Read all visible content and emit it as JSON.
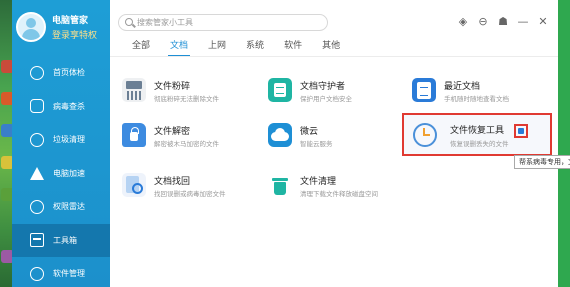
{
  "window": {
    "profile": {
      "name": "电脑管家",
      "vip_link": "登录享特权"
    },
    "sidebar": {
      "items": [
        {
          "label": "首页体检",
          "icon": "home-icon"
        },
        {
          "label": "病毒查杀",
          "icon": "shield-icon"
        },
        {
          "label": "垃圾清理",
          "icon": "trash-icon"
        },
        {
          "label": "电脑加速",
          "icon": "rocket-icon"
        },
        {
          "label": "权限雷达",
          "icon": "radar-icon"
        },
        {
          "label": "工具箱",
          "icon": "toolbox-icon",
          "active": true
        },
        {
          "label": "软件管理",
          "icon": "apps-icon"
        }
      ]
    },
    "search": {
      "placeholder": "搜索管家小工具"
    },
    "toolbar": {
      "icons": [
        "skin-icon",
        "menu-icon",
        "shirt-icon",
        "minimize-icon",
        "close-icon"
      ]
    },
    "tabs": [
      {
        "label": "全部",
        "active": false
      },
      {
        "label": "文档",
        "active": true
      },
      {
        "label": "上网",
        "active": false
      },
      {
        "label": "系统",
        "active": false
      },
      {
        "label": "软件",
        "active": false
      },
      {
        "label": "其他",
        "active": false
      }
    ],
    "tools": [
      {
        "name": "文件粉碎",
        "desc": "彻底粉碎无法删除文件",
        "icon": "shredder-icon"
      },
      {
        "name": "文档守护者",
        "desc": "保护用户文档安全",
        "icon": "document-guard-icon"
      },
      {
        "name": "最近文档",
        "desc": "手机随时随地查看文档",
        "icon": "recent-documents-icon"
      },
      {
        "name": "文件解密",
        "desc": "解密被木马加密的文件",
        "icon": "lock-icon"
      },
      {
        "name": "微云",
        "desc": "智能云服务",
        "icon": "cloud-icon"
      },
      {
        "name": "文件恢复工具",
        "desc": "恢复误删丢失的文件",
        "icon": "restore-clock-icon"
      },
      {
        "name": "文档找回",
        "desc": "找回误删或病毒加密文件",
        "icon": "document-search-icon"
      },
      {
        "name": "文件清理",
        "desc": "清理下载文件释放磁盘空间",
        "icon": "file-clean-icon"
      }
    ],
    "tooltip": "帮系病毒专用，文件"
  },
  "colors": {
    "accent": "#1e8fd5",
    "sidebar": "#1e9ed6",
    "highlight": "#e03a32"
  }
}
